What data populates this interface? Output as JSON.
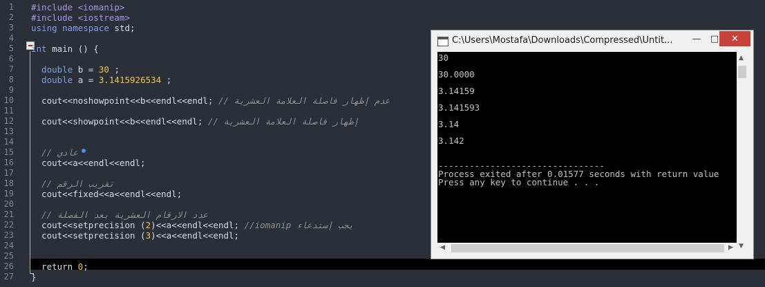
{
  "editor": {
    "line_numbers": [
      "1",
      "2",
      "3",
      "4",
      "5",
      "6",
      "7",
      "8",
      "9",
      "10",
      "11",
      "12",
      "13",
      "14",
      "15",
      "16",
      "17",
      "18",
      "19",
      "20",
      "21",
      "22",
      "23",
      "24",
      "25",
      "26",
      "27"
    ],
    "lines": [
      [
        {
          "t": "#include <iomanip>",
          "c": "pp"
        }
      ],
      [
        {
          "t": "#include <iostream>",
          "c": "pp"
        }
      ],
      [
        {
          "t": "using namespace ",
          "c": "ty"
        },
        {
          "t": "std;",
          "c": ""
        }
      ],
      [],
      [
        {
          "t": "int",
          "c": "ty"
        },
        {
          "t": " main () {",
          "c": ""
        }
      ],
      [],
      [
        {
          "t": "  double",
          "c": "ty"
        },
        {
          "t": " b = ",
          "c": ""
        },
        {
          "t": "30",
          "c": "num"
        },
        {
          "t": " ;",
          "c": ""
        }
      ],
      [
        {
          "t": "  double",
          "c": "ty"
        },
        {
          "t": " a = ",
          "c": ""
        },
        {
          "t": "3.1415926534",
          "c": "num"
        },
        {
          "t": " ;",
          "c": ""
        }
      ],
      [],
      [
        {
          "t": "  cout<<noshowpoint<<b<<endl<<endl; ",
          "c": ""
        },
        {
          "t": "// عدم إظهار فاصلة العلامة العشرية",
          "c": "cm"
        }
      ],
      [],
      [
        {
          "t": "  cout<<showpoint<<b<<endl<<endl; ",
          "c": ""
        },
        {
          "t": "// إظهار فاصلة العلامة العشرية",
          "c": "cm"
        }
      ],
      [],
      [],
      [
        {
          "t": "  // عادي",
          "c": "cm"
        }
      ],
      [
        {
          "t": "  cout<<a<<endl<<endl;",
          "c": ""
        }
      ],
      [],
      [
        {
          "t": "  // تقريب الرقم",
          "c": "cm"
        }
      ],
      [
        {
          "t": "  cout<<fixed<<a<<endl<<endl;",
          "c": ""
        }
      ],
      [],
      [
        {
          "t": "  // عدد الارقام العشرية بعد الفصلة",
          "c": "cm"
        }
      ],
      [
        {
          "t": "  cout<<setprecision (",
          "c": ""
        },
        {
          "t": "2",
          "c": "num"
        },
        {
          "t": ")<<a<<endl<<endl; ",
          "c": ""
        },
        {
          "t": "//iomanip يجب إستدعاء",
          "c": "cm"
        }
      ],
      [
        {
          "t": "  cout<<setprecision (",
          "c": ""
        },
        {
          "t": "3",
          "c": "num"
        },
        {
          "t": ")<<a<<endl<<endl;",
          "c": ""
        }
      ],
      [],
      [],
      [
        {
          "t": "  return ",
          "c": ""
        },
        {
          "t": "0",
          "c": "num"
        },
        {
          "t": ";",
          "c": ""
        }
      ],
      [
        {
          "t": "}",
          "c": ""
        }
      ]
    ]
  },
  "console_window": {
    "title": "C:\\Users\\Mostafa\\Downloads\\Compressed\\Untit...",
    "minimize_icon": "minimize-icon",
    "maximize_icon": "maximize-icon",
    "close_icon": "close-icon",
    "minimize_glyph": "—",
    "maximize_glyph": "□",
    "close_glyph": "✕",
    "output_lines": [
      "30",
      "",
      "30.0000",
      "",
      "3.14159",
      "",
      "3.141593",
      "",
      "3.14",
      "",
      "3.142",
      "",
      "",
      "--------------------------------",
      "Process exited after 0.01577 seconds with return value",
      "Press any key to continue . . ."
    ]
  },
  "colors": {
    "editor_bg": "#2b2f37",
    "number": "#f3c44c",
    "preprocessor": "#aa95e6",
    "keyword": "#7f9ee8",
    "comment": "#8f8f8f",
    "close_button": "#c8413a"
  }
}
